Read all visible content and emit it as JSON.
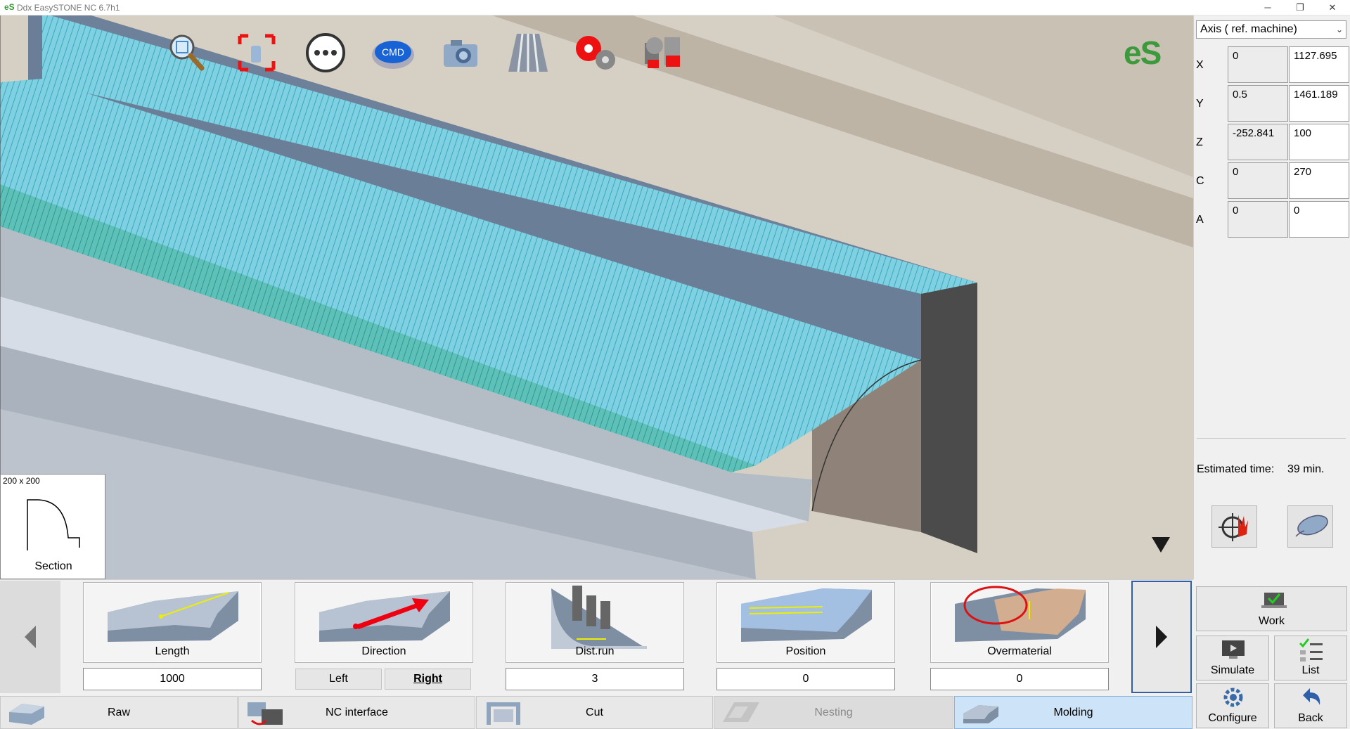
{
  "window": {
    "logo": "eS",
    "title": "Ddx EasySTONE NC 6.7h1",
    "minimize": "─",
    "restore": "❐",
    "close": "✕"
  },
  "toolbar": {
    "icons": [
      "zoom-icon",
      "fit-view-icon",
      "more-icon",
      "cmd-icon",
      "camera-icon",
      "toolpath-icon",
      "tool-settings-icon",
      "machine-icon"
    ],
    "cmd_label": "CMD"
  },
  "brand_logo": "eS",
  "section": {
    "dimensions": "200 x 200",
    "label": "Section"
  },
  "axis_panel": {
    "selected": "Axis ( ref. machine)",
    "rows": [
      {
        "axis": "X",
        "offset": "0",
        "value": "1127.695"
      },
      {
        "axis": "Y",
        "offset": "0.5",
        "value": "1461.189"
      },
      {
        "axis": "Z",
        "offset": "-252.841",
        "value": "100"
      },
      {
        "axis": "C",
        "offset": "0",
        "value": "270"
      },
      {
        "axis": "A",
        "offset": "0",
        "value": "0"
      }
    ],
    "estimated_time_label": "Estimated time:",
    "estimated_time_value": "39 min."
  },
  "params": {
    "length": {
      "label": "Length",
      "value": "1000"
    },
    "direction": {
      "label": "Direction",
      "left": "Left",
      "right": "Right"
    },
    "dist_run": {
      "label": "Dist.run",
      "value": "3"
    },
    "position": {
      "label": "Position",
      "value": "0"
    },
    "overmaterial": {
      "label": "Overmaterial",
      "value": "0"
    }
  },
  "tabs": {
    "raw": "Raw",
    "nc_interface": "NC interface",
    "cut": "Cut",
    "nesting": "Nesting",
    "molding": "Molding"
  },
  "actions": {
    "work": "Work",
    "simulate": "Simulate",
    "list": "List",
    "configure": "Configure",
    "back": "Back"
  },
  "colors": {
    "accent_tab": "#cde3f7",
    "viewport_bg": "#d6cfc4",
    "brand_green": "#3c9a3c"
  }
}
